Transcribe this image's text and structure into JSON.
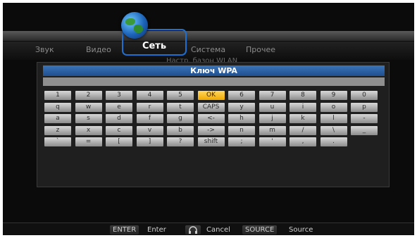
{
  "tabs": [
    {
      "label": "Звук"
    },
    {
      "label": "Видео"
    },
    {
      "label": "Сеть"
    },
    {
      "label": "Система"
    },
    {
      "label": "Прочее"
    }
  ],
  "subtitle": "Настр. базон WLAN",
  "dialog": {
    "title": "Ключ WPA",
    "value": ""
  },
  "keyboard": {
    "rows": [
      [
        "1",
        "2",
        "3",
        "4",
        "5",
        "OK",
        "6",
        "7",
        "8",
        "9",
        "0"
      ],
      [
        "q",
        "w",
        "e",
        "r",
        "t",
        "CAPS",
        "y",
        "u",
        "i",
        "o",
        "p"
      ],
      [
        "a",
        "s",
        "d",
        "f",
        "g",
        "<-",
        "h",
        "j",
        "k",
        "l",
        "-"
      ],
      [
        "z",
        "x",
        "c",
        "v",
        "b",
        "->",
        "n",
        "m",
        "/",
        "\\",
        "_"
      ],
      [
        "`",
        "=",
        "[",
        "]",
        "?",
        "shift",
        ";",
        "'",
        ",",
        "."
      ]
    ],
    "highlighted_key": "OK"
  },
  "help": {
    "enter_key": "ENTER",
    "enter_text": "Enter",
    "cancel_text": "Cancel",
    "source_key": "SOURCE",
    "source_text": "Source"
  },
  "icons": {
    "network_tab": "globe-icon",
    "cancel": "headset-icon"
  },
  "colors": {
    "accent": "#1f6fd0",
    "title_bar": "#2f63a3",
    "key_active": "#f4b400"
  }
}
